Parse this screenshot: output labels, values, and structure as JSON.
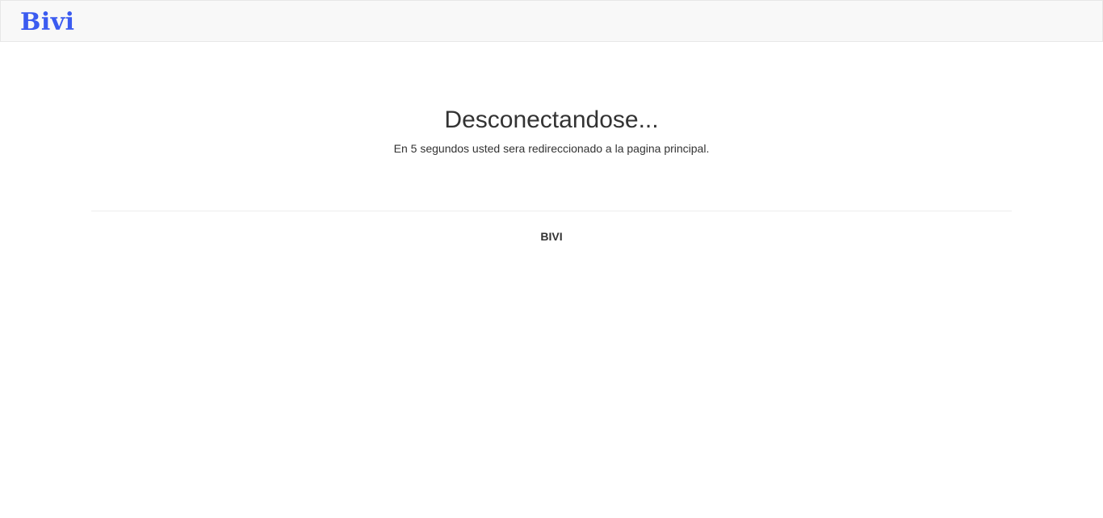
{
  "navbar": {
    "brand": "Bivi"
  },
  "main": {
    "title": "Desconectandose...",
    "message": "En 5 segundos usted sera redireccionado a la pagina principal."
  },
  "footer": {
    "text": "BIVI"
  },
  "colors": {
    "brand": "#3b5bf0",
    "navbar_bg": "#f8f8f8",
    "text": "#333333"
  }
}
